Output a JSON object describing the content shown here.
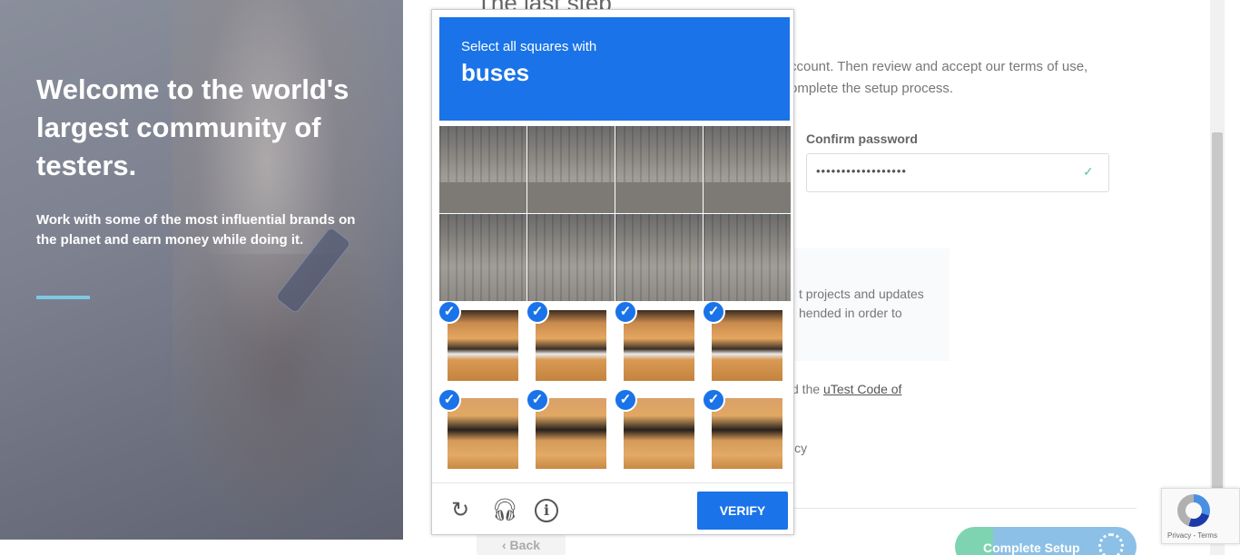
{
  "hero": {
    "heading": "Welcome to the world's largest community of testers.",
    "subheading": "Work with some of the most influential brands on the planet and earn money while doing it."
  },
  "form": {
    "title": "The last step",
    "intro": "ccount. Then review and accept our terms of use, omplete the setup process.",
    "confirm_password_label": "Confirm password",
    "confirm_password_value": "••••••••••••••••••",
    "info_text": "t projects and updates hended in order to",
    "agree_prefix": "d the ",
    "agree_link": "uTest Code of",
    "agree_suffix": "icy",
    "back_label": "Back",
    "complete_label": "Complete Setup"
  },
  "captcha": {
    "prompt": "Select all squares with",
    "target": "buses",
    "verify_label": "VERIFY",
    "tiles": [
      {
        "row": 1,
        "col": 1,
        "selected": false
      },
      {
        "row": 1,
        "col": 2,
        "selected": false
      },
      {
        "row": 1,
        "col": 3,
        "selected": false
      },
      {
        "row": 1,
        "col": 4,
        "selected": false
      },
      {
        "row": 2,
        "col": 1,
        "selected": false
      },
      {
        "row": 2,
        "col": 2,
        "selected": false
      },
      {
        "row": 2,
        "col": 3,
        "selected": false
      },
      {
        "row": 2,
        "col": 4,
        "selected": false
      },
      {
        "row": 3,
        "col": 1,
        "selected": true
      },
      {
        "row": 3,
        "col": 2,
        "selected": true
      },
      {
        "row": 3,
        "col": 3,
        "selected": true
      },
      {
        "row": 3,
        "col": 4,
        "selected": true
      },
      {
        "row": 4,
        "col": 1,
        "selected": true
      },
      {
        "row": 4,
        "col": 2,
        "selected": true
      },
      {
        "row": 4,
        "col": 3,
        "selected": true
      },
      {
        "row": 4,
        "col": 4,
        "selected": true
      }
    ]
  },
  "recaptcha_badge": {
    "links": "Privacy - Terms"
  },
  "icons": [
    "reload-icon",
    "headphones-icon",
    "info-icon",
    "checkmark-icon",
    "chevron-left-icon",
    "spinner-icon",
    "recaptcha-logo-icon"
  ],
  "colors": {
    "captcha_blue": "#1a73e8",
    "hero_accent_bar": "#7ec8e3",
    "complete_button": "#8cc0e6",
    "success_check": "#5cc6a0"
  }
}
